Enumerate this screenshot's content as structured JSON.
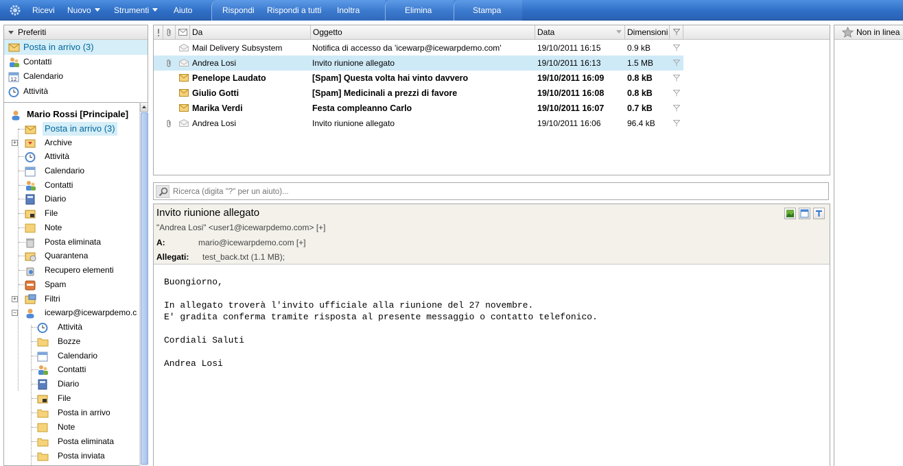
{
  "toolbar": {
    "receive": "Ricevi",
    "new": "Nuovo",
    "tools": "Strumenti",
    "help": "Aiuto",
    "reply": "Rispondi",
    "reply_all": "Rispondi a tutti",
    "forward": "Inoltra",
    "delete": "Elimina",
    "print": "Stampa"
  },
  "favorites": {
    "header": "Preferiti",
    "items": [
      {
        "label": "Posta in arrivo (3)",
        "icon": "inbox-icon"
      },
      {
        "label": "Contatti",
        "icon": "contacts-icon"
      },
      {
        "label": "Calendario",
        "icon": "calendar-icon"
      },
      {
        "label": "Attività",
        "icon": "tasks-icon"
      }
    ]
  },
  "tree": {
    "account": "Mario Rossi [Principale]",
    "items": [
      {
        "label": "Posta in arrivo (3)"
      },
      {
        "label": "Archive"
      },
      {
        "label": "Attività"
      },
      {
        "label": "Calendario"
      },
      {
        "label": "Contatti"
      },
      {
        "label": "Diario"
      },
      {
        "label": "File"
      },
      {
        "label": "Note"
      },
      {
        "label": "Posta eliminata"
      },
      {
        "label": "Quarantena"
      },
      {
        "label": "Recupero elementi"
      },
      {
        "label": "Spam"
      },
      {
        "label": "Filtri"
      },
      {
        "label": "icewarp@icewarpdemo.c"
      }
    ],
    "subitems": [
      {
        "label": "Attività"
      },
      {
        "label": "Bozze"
      },
      {
        "label": "Calendario"
      },
      {
        "label": "Contatti"
      },
      {
        "label": "Diario"
      },
      {
        "label": "File"
      },
      {
        "label": "Posta in arrivo"
      },
      {
        "label": "Note"
      },
      {
        "label": "Posta eliminata"
      },
      {
        "label": "Posta inviata"
      }
    ]
  },
  "list": {
    "columns": {
      "from": "Da",
      "subject": "Oggetto",
      "date": "Data",
      "size": "Dimensioni"
    },
    "rows": [
      {
        "from": "Mail Delivery Subsystem",
        "subject": "Notifica di accesso da 'icewarp@icewarpdemo.com'",
        "date": "19/10/2011 16:15",
        "size": "0.9 kB",
        "unread": false,
        "attachment": false,
        "selected": false
      },
      {
        "from": "Andrea Losi",
        "subject": "Invito riunione allegato",
        "date": "19/10/2011 16:13",
        "size": "1.5 MB",
        "unread": false,
        "attachment": true,
        "selected": true
      },
      {
        "from": "Penelope Laudato",
        "subject": "[Spam] Questa volta hai vinto davvero",
        "date": "19/10/2011 16:09",
        "size": "0.8 kB",
        "unread": true,
        "attachment": false,
        "selected": false
      },
      {
        "from": "Giulio Gotti",
        "subject": "[Spam] Medicinali a prezzi di favore",
        "date": "19/10/2011 16:08",
        "size": "0.8 kB",
        "unread": true,
        "attachment": false,
        "selected": false
      },
      {
        "from": "Marika Verdi",
        "subject": "Festa compleanno Carlo",
        "date": "19/10/2011 16:07",
        "size": "0.7 kB",
        "unread": true,
        "attachment": false,
        "selected": false
      },
      {
        "from": "Andrea Losi",
        "subject": "Invito riunione allegato",
        "date": "19/10/2011 16:06",
        "size": "96.4 kB",
        "unread": false,
        "attachment": true,
        "selected": false
      }
    ]
  },
  "search": {
    "placeholder": "Ricerca (digita \"?\" per un aiuto)..."
  },
  "preview": {
    "subject": "Invito riunione allegato",
    "from": "\"Andrea Losi\" <user1@icewarpdemo.com> [+]",
    "to_label": "A:",
    "to": "mario@icewarpdemo.com [+]",
    "attachments_label": "Allegati:",
    "attachments": "test_back.txt (1.1 MB);",
    "body": "Buongiorno,\n\nIn allegato troverà l'invito ufficiale alla riunione del 27 novembre.\nE' gradita conferma tramite risposta al presente messaggio o contatto telefonico.\n\nCordiali Saluti\n\nAndrea Losi"
  },
  "right_pane": {
    "status": "Non in linea"
  },
  "colors": {
    "toolbar": "#2f6fc6",
    "selection": "#cfeaf7",
    "link": "#00679c"
  }
}
